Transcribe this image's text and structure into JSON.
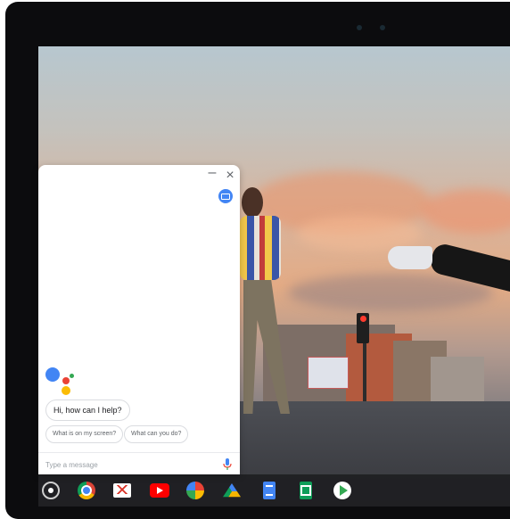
{
  "assistant": {
    "minimize_symbol": "–",
    "close_symbol": "×",
    "greeting": "Hi, how can I help?",
    "suggestions": [
      {
        "label": "What is on my screen?"
      },
      {
        "label": "What can you do?"
      }
    ],
    "input_placeholder": "Type a message",
    "brand_colors": {
      "blue": "#4285f4",
      "red": "#ea4335",
      "yellow": "#fbbc05",
      "green": "#34a853"
    }
  },
  "shelf": {
    "apps": [
      {
        "icon": "launcher-icon"
      },
      {
        "icon": "chrome-icon"
      },
      {
        "icon": "gmail-icon"
      },
      {
        "icon": "youtube-icon"
      },
      {
        "icon": "photos-icon"
      },
      {
        "icon": "drive-icon"
      },
      {
        "icon": "docs-icon"
      },
      {
        "icon": "sheets-icon"
      },
      {
        "icon": "play-store-icon"
      }
    ]
  }
}
